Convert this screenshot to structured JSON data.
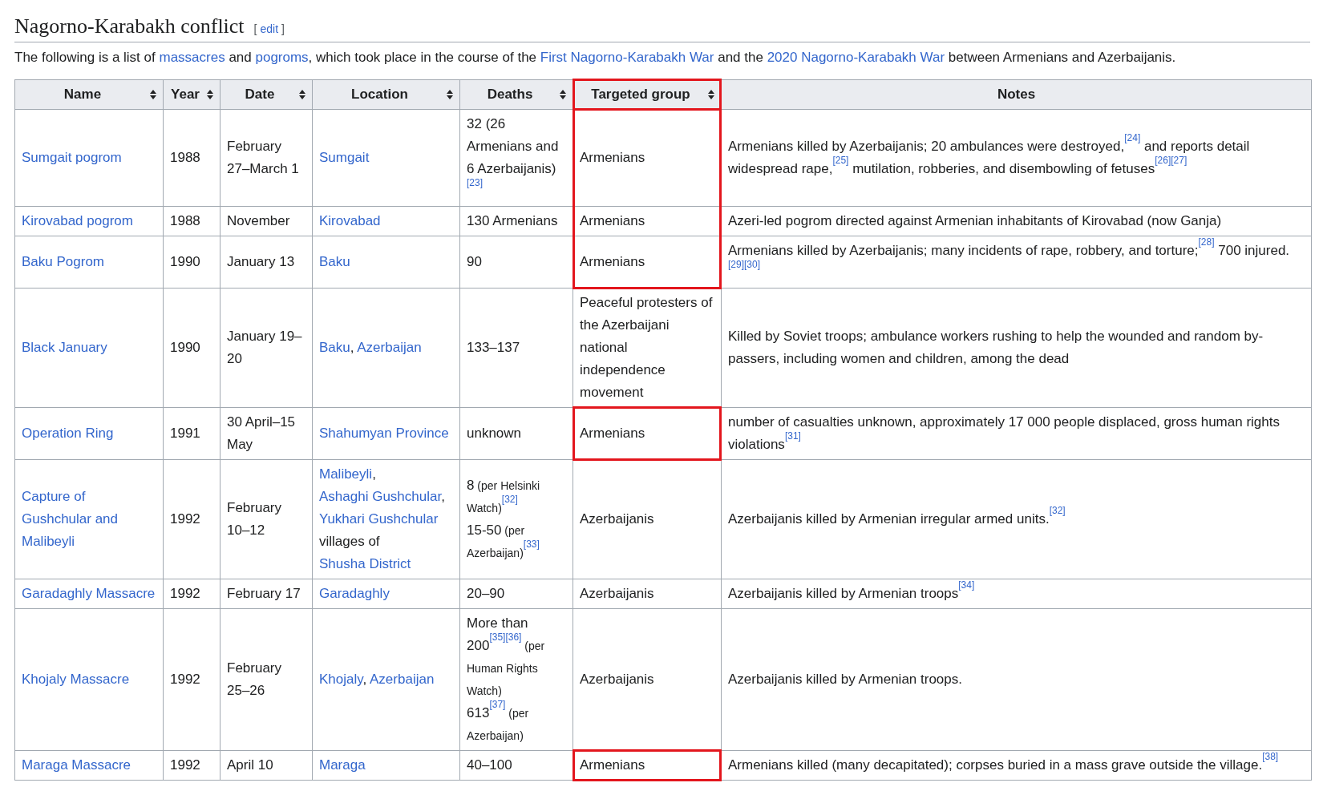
{
  "section": {
    "title": "Nagorno-Karabakh conflict",
    "edit_open": "[",
    "edit_link": "edit",
    "edit_close": "]"
  },
  "intro": [
    {
      "text": "The following is a list of ",
      "kind": "text"
    },
    {
      "text": "massacres",
      "kind": "link"
    },
    {
      "text": " and ",
      "kind": "text"
    },
    {
      "text": "pogroms",
      "kind": "link"
    },
    {
      "text": ", which took place in the course of the ",
      "kind": "text"
    },
    {
      "text": "First Nagorno-Karabakh War",
      "kind": "link"
    },
    {
      "text": " and the ",
      "kind": "text"
    },
    {
      "text": "2020 Nagorno-Karabakh War",
      "kind": "link"
    },
    {
      "text": " between Armenians and Azerbaijanis.",
      "kind": "text"
    }
  ],
  "table": {
    "columns": [
      {
        "label": "Name",
        "sortable": true,
        "highlighted": false
      },
      {
        "label": "Year",
        "sortable": true,
        "highlighted": false
      },
      {
        "label": "Date",
        "sortable": true,
        "highlighted": false
      },
      {
        "label": "Location",
        "sortable": true,
        "highlighted": false
      },
      {
        "label": "Deaths",
        "sortable": true,
        "highlighted": false
      },
      {
        "label": "Targeted group",
        "sortable": true,
        "highlighted": true
      },
      {
        "label": "Notes",
        "sortable": false,
        "highlighted": false
      }
    ],
    "rows": [
      {
        "name": "Sumgait pogrom",
        "year": "1988",
        "date": "February 27–March 1",
        "location": [
          {
            "text": "Sumgait",
            "kind": "link"
          }
        ],
        "deaths": [
          [
            {
              "text": "32 (26 Armenians and 6 Azerbaijanis)$^{[23]}$",
              "kind": "count"
            }
          ]
        ],
        "target": "Armenians",
        "target_highlighted": true,
        "notes": "Armenians killed by Azerbaijanis; 20 ambulances were destroyed,$^{[24]}$ and reports detail widespread rape,$^{[25]}$ mutilation, robberies, and disembowling of fetuses$^{[26][27]}$"
      },
      {
        "name": "Kirovabad pogrom",
        "year": "1988",
        "date": "November",
        "location": [
          {
            "text": "Kirovabad",
            "kind": "link"
          }
        ],
        "deaths": [
          [
            {
              "text": "130 Armenians",
              "kind": "count"
            }
          ]
        ],
        "target": "Armenians",
        "target_highlighted": true,
        "notes": "Azeri-led pogrom directed against Armenian inhabitants of Kirovabad (now Ganja)"
      },
      {
        "name": "Baku Pogrom",
        "year": "1990",
        "date": "January 13",
        "location": [
          {
            "text": "Baku",
            "kind": "link"
          }
        ],
        "deaths": [
          [
            {
              "text": "90",
              "kind": "count"
            }
          ]
        ],
        "target": "Armenians",
        "target_highlighted": true,
        "notes": "Armenians killed by Azerbaijanis; many incidents of rape, robbery, and torture;$^{[28]}$ 700 injured.$^{[29][30]}$"
      },
      {
        "name": "Black January",
        "year": "1990",
        "date": "January 19–20",
        "location": [
          {
            "text": "Baku",
            "kind": "link"
          },
          {
            "text": ", ",
            "kind": "text"
          },
          {
            "text": "Azerbaijan",
            "kind": "link"
          }
        ],
        "deaths": [
          [
            {
              "text": "133–137",
              "kind": "count"
            }
          ]
        ],
        "target": "Peaceful protesters of the Azerbaijani national independence movement",
        "target_highlighted": false,
        "notes": "Killed by Soviet troops; ambulance workers rushing to help the wounded and random by-passers, including women and children, among the dead"
      },
      {
        "name": "Operation Ring",
        "year": "1991",
        "date": "30 April–15 May",
        "location": [
          {
            "text": "Shahumyan Province",
            "kind": "link"
          }
        ],
        "deaths": [
          [
            {
              "text": "unknown",
              "kind": "count"
            }
          ]
        ],
        "target": "Armenians",
        "target_highlighted": true,
        "notes": "number of casualties unknown, approximately 17 000 people displaced, gross human rights violations$^{[31]}$"
      },
      {
        "name": "Capture of Gushchular and Malibeyli",
        "year": "1992",
        "date": "February 10–12",
        "location": [
          {
            "text": "Malibeyli",
            "kind": "link"
          },
          {
            "text": ", ",
            "kind": "text"
          },
          {
            "text": "Ashaghi Gushchular",
            "kind": "link"
          },
          {
            "text": ", ",
            "kind": "text"
          },
          {
            "text": "Yukhari Gushchular",
            "kind": "link"
          },
          {
            "text": " villages of ",
            "kind": "text"
          },
          {
            "text": "Shusha District",
            "kind": "link"
          }
        ],
        "deaths": [
          [
            {
              "text": "8",
              "kind": "count"
            },
            {
              "text": " (per Helsinki Watch)$^{[32]}$",
              "kind": "source"
            }
          ],
          [
            {
              "text": "15-50",
              "kind": "count"
            },
            {
              "text": " (per Azerbaijan)$^{[33]}$",
              "kind": "source"
            }
          ]
        ],
        "target": "Azerbaijanis",
        "target_highlighted": false,
        "notes": "Azerbaijanis killed by Armenian irregular armed units.$^{[32]}$"
      },
      {
        "name": "Garadaghly Massacre",
        "year": "1992",
        "date": "February 17",
        "location": [
          {
            "text": "Garadaghly",
            "kind": "link"
          }
        ],
        "deaths": [
          [
            {
              "text": "20–90",
              "kind": "count"
            }
          ]
        ],
        "target": "Azerbaijanis",
        "target_highlighted": false,
        "notes": "Azerbaijanis killed by Armenian troops$^{[34]}$"
      },
      {
        "name": "Khojaly Massacre",
        "year": "1992",
        "date": "February 25–26",
        "location": [
          {
            "text": "Khojaly",
            "kind": "link"
          },
          {
            "text": ", ",
            "kind": "text"
          },
          {
            "text": "Azerbaijan",
            "kind": "link"
          }
        ],
        "deaths": [
          [
            {
              "text": "More than 200$^{[35][36]}$",
              "kind": "count"
            },
            {
              "text": " (per Human Rights Watch)",
              "kind": "source"
            }
          ],
          [
            {
              "text": "613$^{[37]}$",
              "kind": "count"
            },
            {
              "text": " (per Azerbaijan)",
              "kind": "source"
            }
          ]
        ],
        "target": "Azerbaijanis",
        "target_highlighted": false,
        "notes": "Azerbaijanis killed by Armenian troops."
      },
      {
        "name": "Maraga Massacre",
        "year": "1992",
        "date": "April 10",
        "location": [
          {
            "text": "Maraga",
            "kind": "link"
          }
        ],
        "deaths": [
          [
            {
              "text": "40–100",
              "kind": "count"
            }
          ]
        ],
        "target": "Armenians",
        "target_highlighted": true,
        "notes": "Armenians killed (many decapitated); corpses buried in a mass grave outside the village.$^{[38]}$"
      }
    ]
  }
}
